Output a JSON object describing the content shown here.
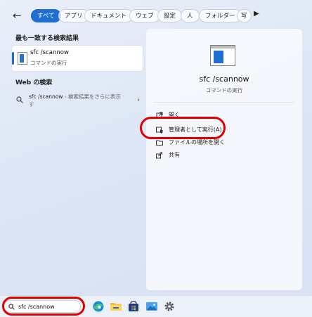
{
  "filters": {
    "back_glyph": "←",
    "chips": [
      "すべて",
      "アプリ",
      "ドキュメント",
      "ウェブ",
      "設定",
      "人",
      "フォルダー",
      "写"
    ],
    "more_glyph": "▶"
  },
  "left": {
    "best_match_heading": "最も一致する検索結果",
    "best_match": {
      "title": "sfc /scannow",
      "subtitle": "コマンドの実行"
    },
    "web_heading": "Web の検索",
    "web_result": {
      "query": "sfc /scannow",
      "suffix": " - 検索結果をさらに表示",
      "line2": "す",
      "chevron": "›"
    }
  },
  "right": {
    "title": "sfc /scannow",
    "subtitle": "コマンドの実行",
    "actions": [
      {
        "label": "開く",
        "icon": "open-external-icon"
      },
      {
        "label": "管理者として実行(A)",
        "icon": "admin-shield-icon"
      },
      {
        "label": "ファイルの場所を開く",
        "icon": "folder-icon"
      },
      {
        "label": "共有",
        "icon": "share-icon"
      }
    ]
  },
  "taskbar": {
    "search_value": "sfc /scannow",
    "icons": [
      "edge-icon",
      "file-explorer-icon",
      "microsoft-store-icon",
      "photos-icon",
      "settings-gear-icon"
    ]
  },
  "colors": {
    "accent": "#1f6fd1",
    "highlight_oval": "#e00000"
  }
}
